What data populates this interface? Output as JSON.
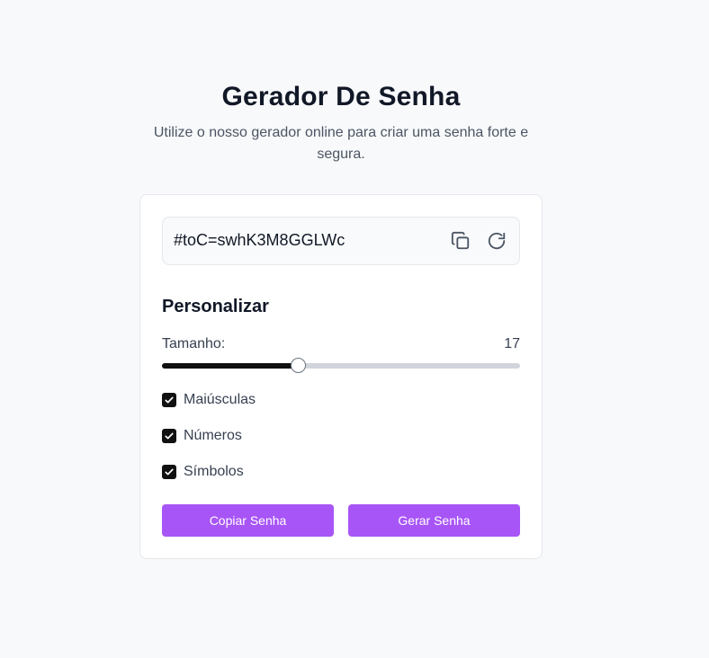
{
  "header": {
    "title": "Gerador De Senha",
    "subtitle": "Utilize o nosso gerador online para criar uma senha forte e segura."
  },
  "password": {
    "value": "#toC=swhK3M8GGLWc",
    "copy_icon": "copy-icon",
    "refresh_icon": "refresh-icon"
  },
  "customize": {
    "title": "Personalizar",
    "length_label": "Tamanho:",
    "length_value": "17",
    "slider_fraction": 0.38,
    "options": [
      {
        "label": "Maiúsculas",
        "checked": true
      },
      {
        "label": "Números",
        "checked": true
      },
      {
        "label": "Símbolos",
        "checked": true
      }
    ]
  },
  "actions": {
    "copy_label": "Copiar Senha",
    "generate_label": "Gerar Senha"
  },
  "colors": {
    "accent": "#a855f7",
    "background": "#f8f9fb",
    "checkbox": "#111111"
  }
}
